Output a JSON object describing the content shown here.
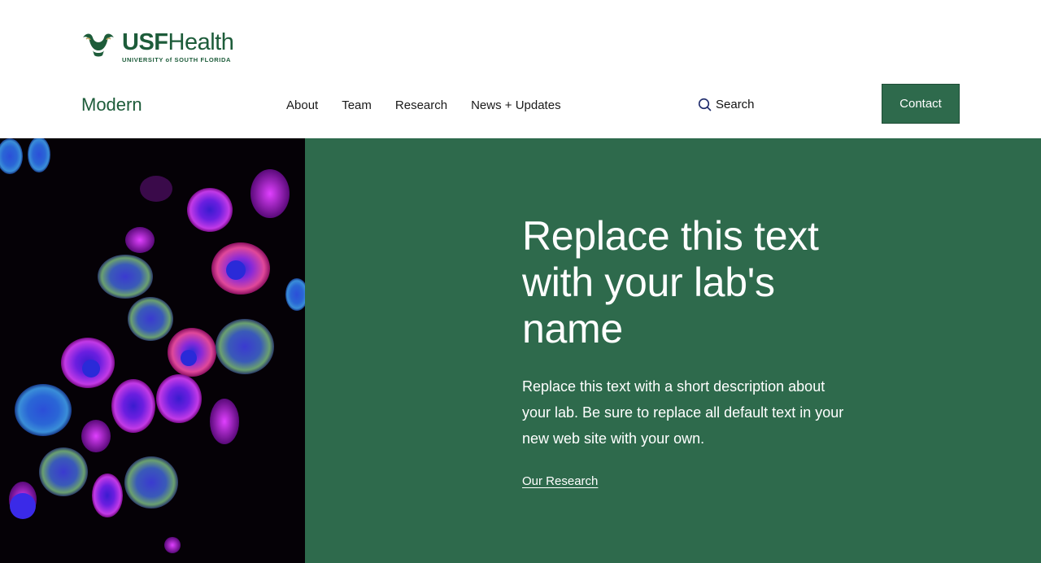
{
  "brand": {
    "logo_usf": "USF",
    "logo_health": "Health",
    "logo_sub": "UNIVERSITY of SOUTH FLORIDA",
    "primary_color": "#2e6a4c",
    "logo_color": "#1d5c3a"
  },
  "site_name": "Modern",
  "nav": {
    "items": [
      {
        "label": "About"
      },
      {
        "label": "Team"
      },
      {
        "label": "Research"
      },
      {
        "label": "News + Updates"
      }
    ]
  },
  "search": {
    "label": "Search",
    "icon": "search-icon"
  },
  "contact": {
    "label": "Contact"
  },
  "hero": {
    "image": "fluorescent-cells-microscopy",
    "title": "Replace this text with your lab's name",
    "description": "Replace this text with a short description about your lab. Be sure to replace all default text in your new web site with your own.",
    "link_label": "Our Research"
  }
}
